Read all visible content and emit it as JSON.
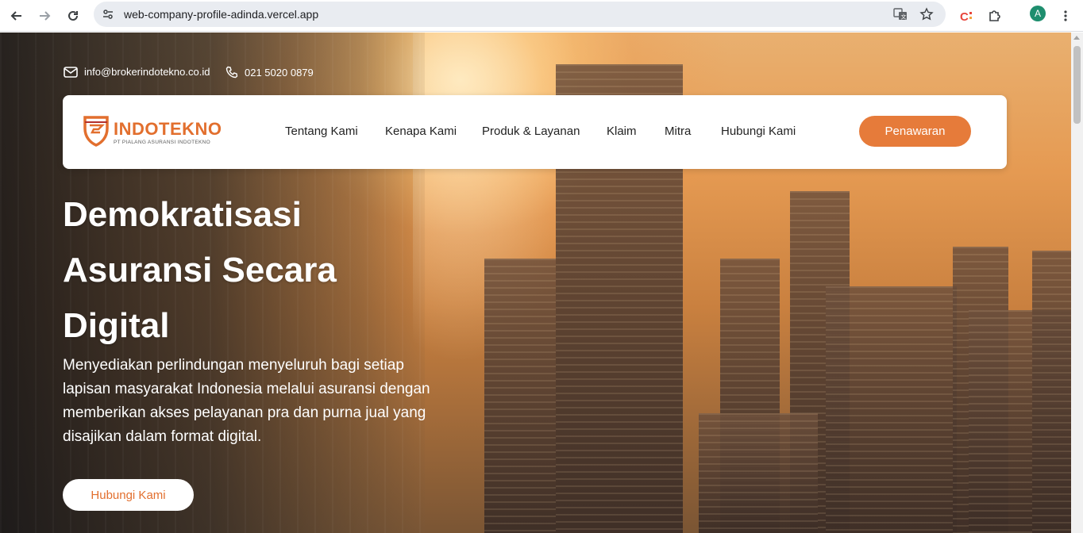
{
  "browser": {
    "url": "web-company-profile-adinda.vercel.app",
    "profile_initial": "A",
    "icons": [
      "back-arrow-icon",
      "forward-arrow-icon",
      "reload-icon",
      "site-settings-icon",
      "translate-icon",
      "bookmark-star-icon",
      "extension-icon",
      "puzzle-icon",
      "more-vert-icon"
    ]
  },
  "contact": {
    "email": "info@brokerindotekno.co.id",
    "phone": "021 5020 0879"
  },
  "brand": {
    "name": "INDOTEKNO",
    "tagline": "PT PIALANG ASURANSI INDOTEKNO",
    "accent_color": "#e67b3a"
  },
  "nav": {
    "items": [
      {
        "label": "Tentang Kami"
      },
      {
        "label": "Kenapa Kami"
      },
      {
        "label": "Produk & Layanan"
      },
      {
        "label": "Klaim"
      },
      {
        "label": "Mitra"
      },
      {
        "label": "Hubungi Kami"
      }
    ],
    "cta_label": "Penawaran"
  },
  "hero": {
    "title_lines": [
      "Demokratisasi",
      "Asuransi Secara",
      "Digital"
    ],
    "description": "Menyediakan perlindungan menyeluruh bagi setiap lapisan masyarakat Indonesia melalui asuransi dengan memberikan akses pelayanan pra dan purna jual yang disajikan dalam format digital.",
    "button_label": "Hubungi Kami"
  }
}
